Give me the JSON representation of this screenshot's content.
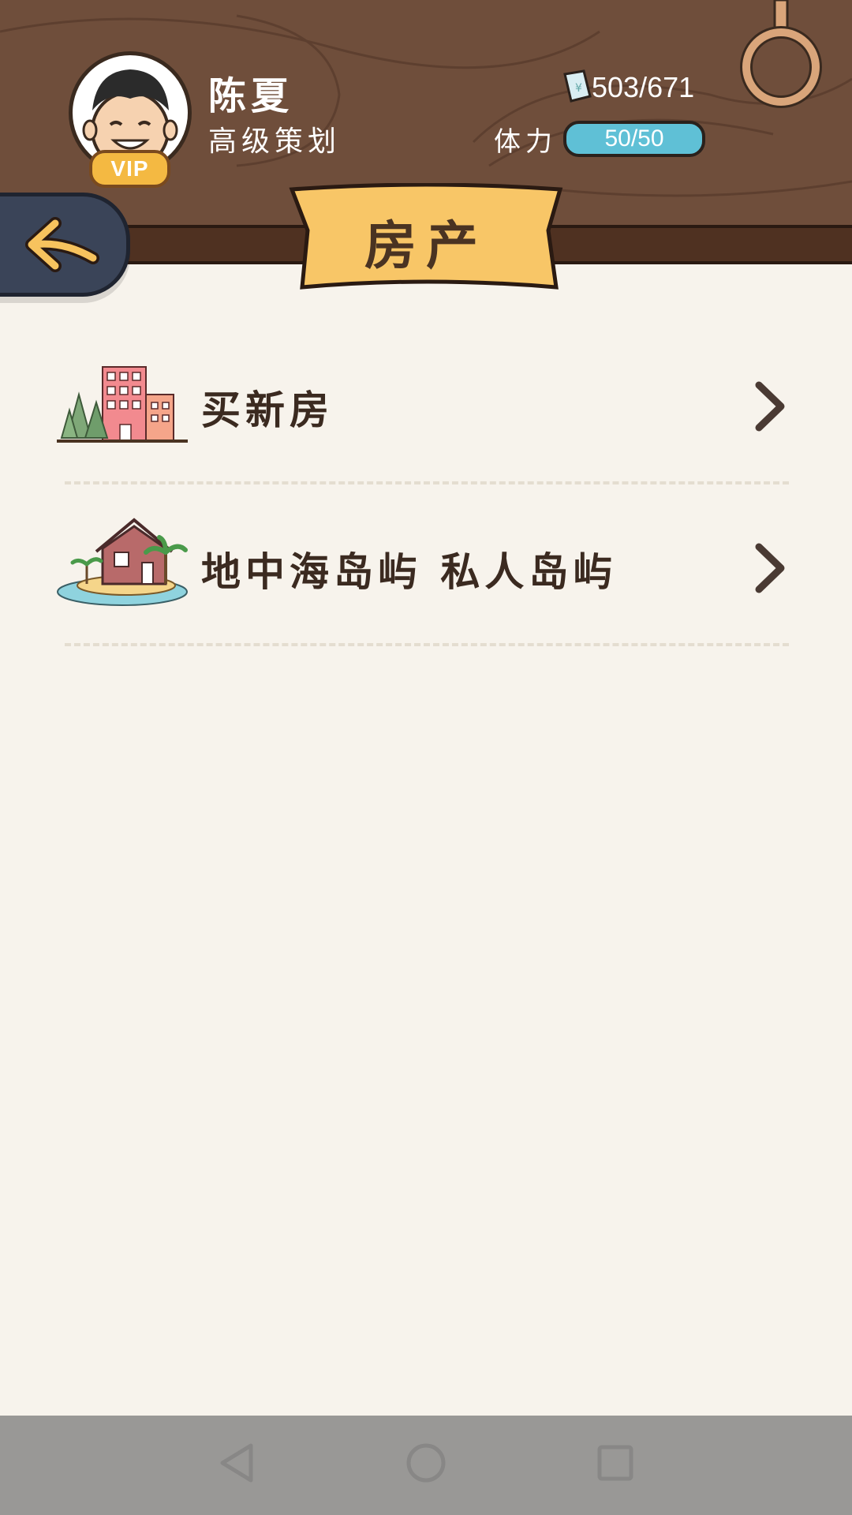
{
  "profile": {
    "name": "陈夏",
    "title": "高级策划",
    "vip_label": "VIP"
  },
  "stats": {
    "money": "503/671",
    "stamina_label": "体力",
    "stamina_value": "50/50"
  },
  "page": {
    "title": "房产"
  },
  "list": {
    "items": [
      {
        "label": "买新房",
        "icon": "apartment-building-icon"
      },
      {
        "label": "地中海岛屿 私人岛屿",
        "icon": "island-house-icon"
      }
    ]
  },
  "colors": {
    "wood": "#6f4e3b",
    "banner": "#f8c667",
    "stamina": "#5fc0d6",
    "background": "#f7f3ec",
    "nav": "#999896"
  }
}
